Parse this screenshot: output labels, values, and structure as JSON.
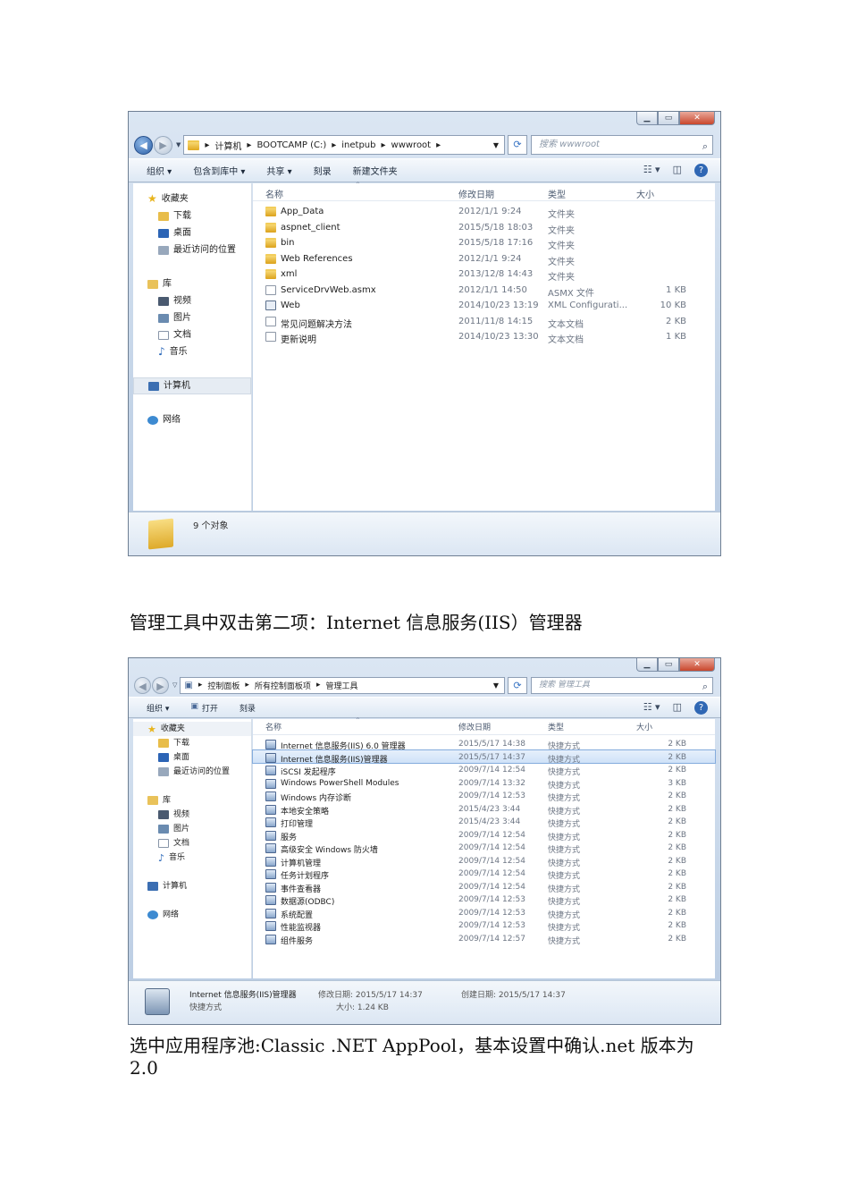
{
  "window1": {
    "path": [
      "计算机",
      "BOOTCAMP (C:)",
      "inetpub",
      "wwwroot"
    ],
    "search_placeholder": "搜索 wwwroot",
    "toolbar": [
      "组织 ▾",
      "包含到库中 ▾",
      "共享 ▾",
      "刻录",
      "新建文件夹"
    ],
    "columns": {
      "name": "名称",
      "date": "修改日期",
      "type": "类型",
      "size": "大小"
    },
    "rows": [
      {
        "name": "App_Data",
        "date": "2012/1/1 9:24",
        "type": "文件夹",
        "size": "",
        "icon": "folder"
      },
      {
        "name": "aspnet_client",
        "date": "2015/5/18 18:03",
        "type": "文件夹",
        "size": "",
        "icon": "folder"
      },
      {
        "name": "bin",
        "date": "2015/5/18 17:16",
        "type": "文件夹",
        "size": "",
        "icon": "folder"
      },
      {
        "name": "Web References",
        "date": "2012/1/1 9:24",
        "type": "文件夹",
        "size": "",
        "icon": "folder"
      },
      {
        "name": "xml",
        "date": "2013/12/8 14:43",
        "type": "文件夹",
        "size": "",
        "icon": "folder"
      },
      {
        "name": "ServiceDrvWeb.asmx",
        "date": "2012/1/1 14:50",
        "type": "ASMX 文件",
        "size": "1 KB",
        "icon": "file"
      },
      {
        "name": "Web",
        "date": "2014/10/23 13:19",
        "type": "XML Configurati...",
        "size": "10 KB",
        "icon": "xml"
      },
      {
        "name": "常见问题解决方法",
        "date": "2011/11/8 14:15",
        "type": "文本文档",
        "size": "2 KB",
        "icon": "file"
      },
      {
        "name": "更新说明",
        "date": "2014/10/23 13:30",
        "type": "文本文档",
        "size": "1 KB",
        "icon": "file"
      }
    ],
    "status": "9 个对象"
  },
  "sidebar": {
    "favorites": "收藏夹",
    "downloads": "下载",
    "desktop": "桌面",
    "recent": "最近访问的位置",
    "libraries": "库",
    "videos": "视频",
    "pictures": "图片",
    "documents": "文档",
    "music": "音乐",
    "computer": "计算机",
    "network": "网络"
  },
  "caption1": "管理工具中双击第二项：Internet 信息服务(IIS）管理器",
  "window2": {
    "path": [
      "控制面板",
      "所有控制面板项",
      "管理工具"
    ],
    "search_placeholder": "搜索 管理工具",
    "toolbar": [
      "组织 ▾",
      "打开",
      "刻录"
    ],
    "rows": [
      {
        "name": "Internet 信息服务(IIS) 6.0 管理器",
        "date": "2015/5/17 14:38",
        "type": "快捷方式",
        "size": "2 KB"
      },
      {
        "name": "Internet 信息服务(IIS)管理器",
        "date": "2015/5/17 14:37",
        "type": "快捷方式",
        "size": "2 KB"
      },
      {
        "name": "iSCSI 发起程序",
        "date": "2009/7/14 12:54",
        "type": "快捷方式",
        "size": "2 KB"
      },
      {
        "name": "Windows PowerShell Modules",
        "date": "2009/7/14 13:32",
        "type": "快捷方式",
        "size": "3 KB"
      },
      {
        "name": "Windows 内存诊断",
        "date": "2009/7/14 12:53",
        "type": "快捷方式",
        "size": "2 KB"
      },
      {
        "name": "本地安全策略",
        "date": "2015/4/23 3:44",
        "type": "快捷方式",
        "size": "2 KB"
      },
      {
        "name": "打印管理",
        "date": "2015/4/23 3:44",
        "type": "快捷方式",
        "size": "2 KB"
      },
      {
        "name": "服务",
        "date": "2009/7/14 12:54",
        "type": "快捷方式",
        "size": "2 KB"
      },
      {
        "name": "高级安全 Windows 防火墙",
        "date": "2009/7/14 12:54",
        "type": "快捷方式",
        "size": "2 KB"
      },
      {
        "name": "计算机管理",
        "date": "2009/7/14 12:54",
        "type": "快捷方式",
        "size": "2 KB"
      },
      {
        "name": "任务计划程序",
        "date": "2009/7/14 12:54",
        "type": "快捷方式",
        "size": "2 KB"
      },
      {
        "name": "事件查看器",
        "date": "2009/7/14 12:54",
        "type": "快捷方式",
        "size": "2 KB"
      },
      {
        "name": "数据源(ODBC)",
        "date": "2009/7/14 12:53",
        "type": "快捷方式",
        "size": "2 KB"
      },
      {
        "name": "系统配置",
        "date": "2009/7/14 12:53",
        "type": "快捷方式",
        "size": "2 KB"
      },
      {
        "name": "性能监视器",
        "date": "2009/7/14 12:53",
        "type": "快捷方式",
        "size": "2 KB"
      },
      {
        "name": "组件服务",
        "date": "2009/7/14 12:57",
        "type": "快捷方式",
        "size": "2 KB"
      }
    ],
    "details": {
      "name": "Internet 信息服务(IIS)管理器",
      "modified": "修改日期: 2015/5/17 14:37",
      "created": "创建日期: 2015/5/17 14:37",
      "type": "快捷方式",
      "size": "大小: 1.24 KB"
    }
  },
  "caption2_line1": "选中应用程序池:Classic .NET AppPool，基本设置中确认.net 版本为",
  "caption2_line2": "2.0"
}
